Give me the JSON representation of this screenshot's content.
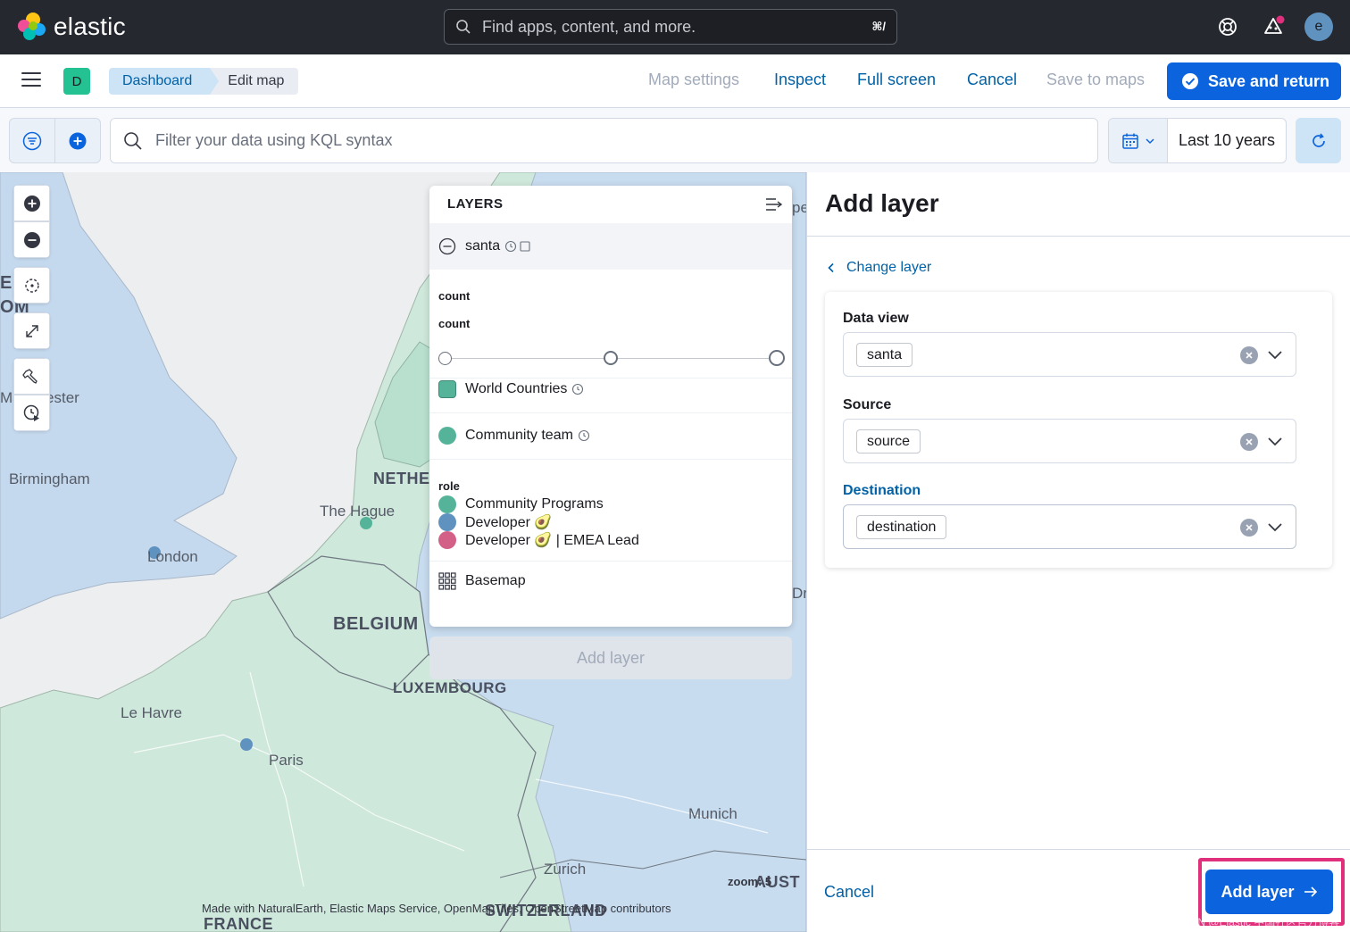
{
  "header": {
    "logo_text": "elastic",
    "search_placeholder": "Find apps, content, and more.",
    "search_shortcut": "⌘/",
    "avatar_initial": "e"
  },
  "appbar": {
    "space_badge": "D",
    "breadcrumbs": [
      "Dashboard",
      "Edit map"
    ],
    "links": {
      "map_settings": "Map settings",
      "inspect": "Inspect",
      "full_screen": "Full screen",
      "cancel": "Cancel",
      "save_to_maps": "Save to maps"
    },
    "save_return": "Save and return"
  },
  "filterbar": {
    "kql_placeholder": "Filter your data using KQL syntax",
    "time_range": "Last 10 years"
  },
  "map": {
    "labels": {
      "manchester": "Manchester",
      "birmingham": "Birmingham",
      "the_hague": "The Hague",
      "london": "London",
      "belgium": "BELGIUM",
      "luxembourg": "LUXEMBOURG",
      "le_havre": "Le Havre",
      "paris": "Paris",
      "munich": "Munich",
      "zurich": "Zurich",
      "switzerland": "SWITZERLAND",
      "france": "FRANCE",
      "nether": "NETHER",
      "austria": "AUST",
      "left_el": "EI",
      "left_om": "OM",
      "right_pe": "pe",
      "right_dr": "Dr"
    },
    "zoom": "zoom: 5",
    "attribution": "Made with NaturalEarth, Elastic Maps Service, OpenMapTiles, OpenStreetMap contributors"
  },
  "layers": {
    "title": "LAYERS",
    "santa": "santa",
    "count_label_1": "count",
    "count_label_2": "count",
    "world_countries": "World Countries",
    "community_team": "Community team",
    "role_label": "role",
    "roles": [
      {
        "label": "Community Programs",
        "color": "#54b399"
      },
      {
        "label": "Developer 🥑",
        "color": "#6092c0"
      },
      {
        "label": "Developer 🥑 | EMEA Lead",
        "color": "#d36086"
      }
    ],
    "basemap": "Basemap",
    "add_layer": "Add layer"
  },
  "flyout": {
    "title": "Add layer",
    "change_layer": "Change layer",
    "fields": {
      "data_view_label": "Data view",
      "data_view_value": "santa",
      "source_label": "Source",
      "source_value": "source",
      "destination_label": "Destination",
      "destination_value": "destination"
    },
    "cancel": "Cancel",
    "add_layer": "Add layer",
    "watermark": "CSDN @Elastic 中国社区官方博客"
  },
  "colors": {
    "primary": "#0b64dd",
    "link": "#0061a6",
    "highlight": "#e0307c",
    "map_land": "#cfe8dc",
    "map_water": "#c5d9ee"
  }
}
